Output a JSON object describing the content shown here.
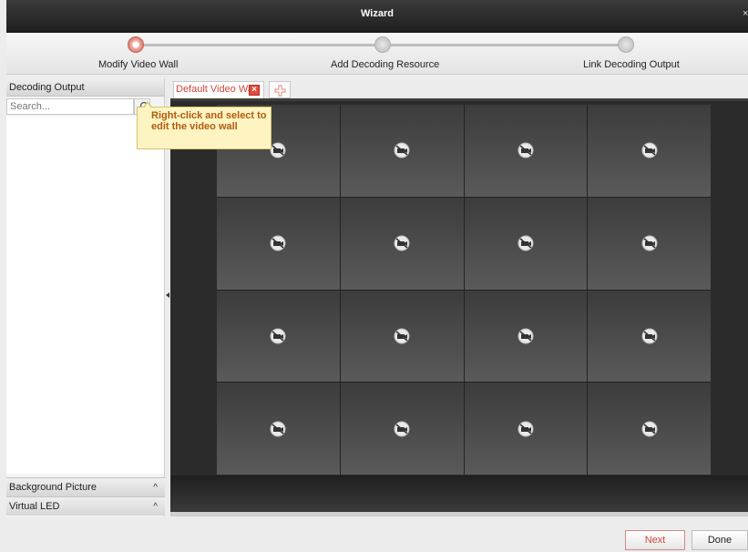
{
  "window": {
    "title": "Wizard",
    "close_label": "×"
  },
  "steps": [
    {
      "label": "Modify Video Wall",
      "active": true
    },
    {
      "label": "Add Decoding Resource",
      "active": false
    },
    {
      "label": "Link Decoding Output",
      "active": false
    }
  ],
  "left_panel": {
    "header": "Decoding Output",
    "search_placeholder": "Search...",
    "sections": [
      {
        "label": "Background Picture",
        "caret": "^"
      },
      {
        "label": "Virtual LED",
        "caret": "^"
      }
    ]
  },
  "tabs": {
    "items": [
      {
        "label": "Default Video Wall",
        "close": "×"
      }
    ],
    "add_icon": "plus-icon"
  },
  "tooltip": {
    "line1": "Right-click and select to",
    "line2": "edit the video wall"
  },
  "video_wall": {
    "rows": 4,
    "columns": 4,
    "cell_icon": "no-video-icon"
  },
  "footer": {
    "next_label": "Next",
    "done_label": "Done"
  },
  "colors": {
    "accent": "#d2463a",
    "titlebar": "#2a2a2a",
    "wall_bg": "#2b2b2b",
    "tooltip_bg": "#fdf4c2"
  }
}
